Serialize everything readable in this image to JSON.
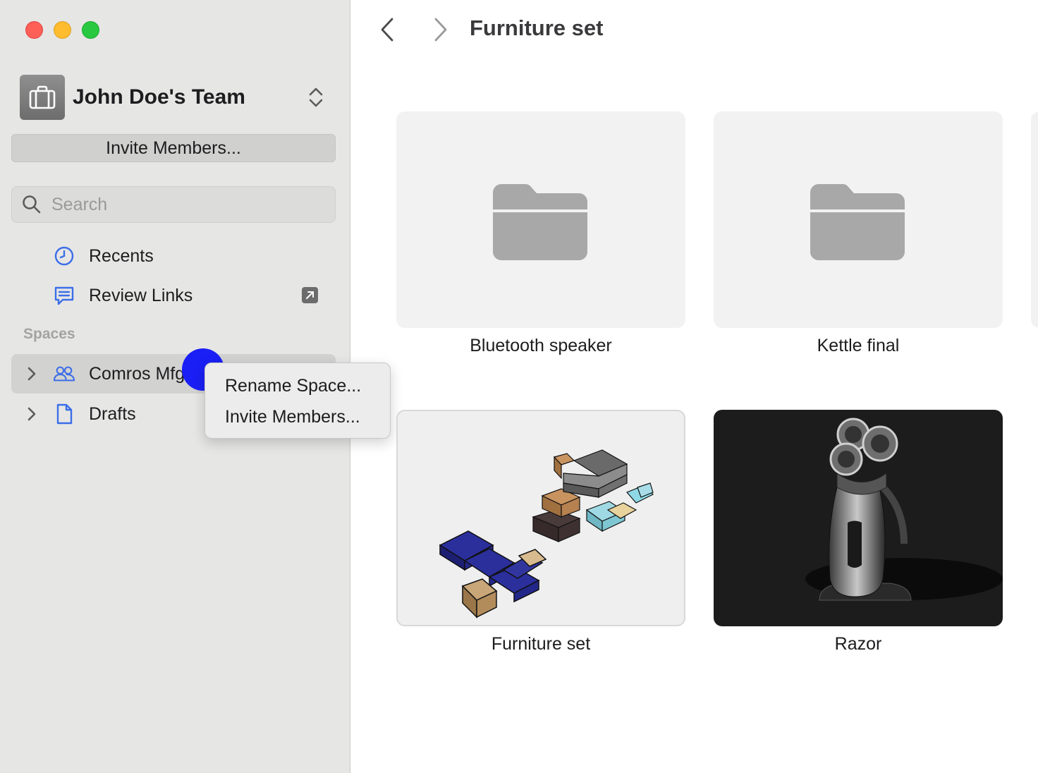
{
  "sidebar": {
    "team_name": "John Doe's Team",
    "invite_label": "Invite Members...",
    "search_placeholder": "Search",
    "nav": {
      "recents": "Recents",
      "review_links": "Review Links"
    },
    "spaces_title": "Spaces",
    "spaces": [
      {
        "label": "Comros Mfg"
      },
      {
        "label": "Drafts"
      }
    ]
  },
  "context_menu": {
    "items": [
      {
        "label": "Rename Space..."
      },
      {
        "label": "Invite Members..."
      }
    ]
  },
  "main": {
    "title": "Furniture set",
    "items": [
      {
        "label": "Bluetooth speaker",
        "kind": "folder"
      },
      {
        "label": "Kettle final",
        "kind": "folder"
      },
      {
        "label": "Furniture set",
        "kind": "model"
      },
      {
        "label": "Razor",
        "kind": "model"
      }
    ]
  },
  "colors": {
    "accent": "#3b6ee8",
    "cursor": "#1a1ff5"
  }
}
